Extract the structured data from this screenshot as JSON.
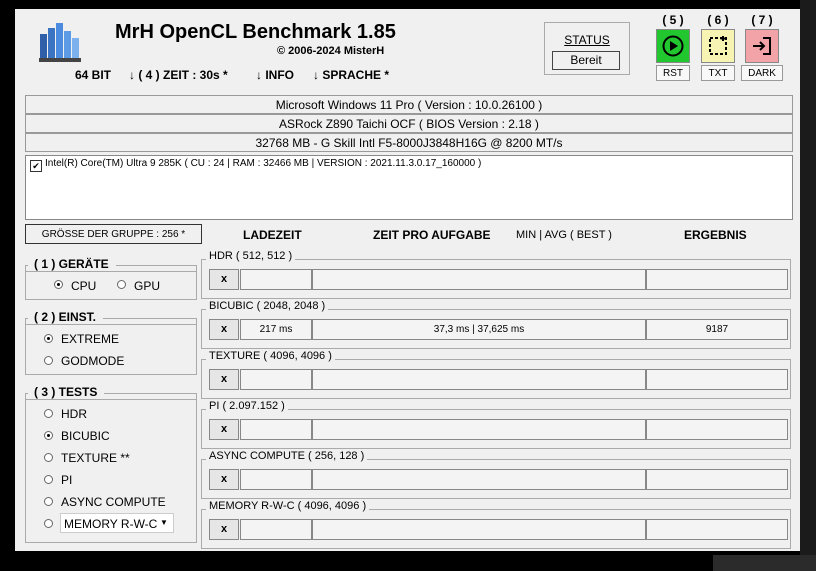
{
  "app": {
    "title": "MrH OpenCL Benchmark 1.85",
    "copyright": "© 2006-2024 MisterH"
  },
  "menu": {
    "bits": "64 BIT",
    "time": "↓ ( 4 ) ZEIT : 30s *",
    "info": "↓ INFO",
    "language": "↓ SPRACHE *"
  },
  "status": {
    "label": "STATUS",
    "value": "Bereit"
  },
  "toolbar": [
    {
      "num": "( 5 )",
      "label": "RST",
      "icon": "play-icon",
      "color": "#22c62e"
    },
    {
      "num": "( 6 )",
      "label": "TXT",
      "icon": "select-icon",
      "color": "#f6f3b3"
    },
    {
      "num": "( 7 )",
      "label": "DARK",
      "icon": "exit-icon",
      "color": "#f2a3a8"
    }
  ],
  "system": {
    "os": "Microsoft Windows 11 Pro ( Version : 10.0.26100 )",
    "board": "ASRock Z890 Taichi OCF ( BIOS Version : 2.18 )",
    "memory": "32768 MB - G Skill Intl F5-8000J3848H16G    @ 8200 MT/s"
  },
  "device": {
    "checked": true,
    "text": "Intel(R) Core(TM) Ultra 9 285K ( CU : 24 | RAM : 32466 MB | VERSION : 2021.11.3.0.17_160000 )"
  },
  "group_size": "GRÖSSE DER GRUPPE : 256 *",
  "columns": {
    "load": "LADEZEIT",
    "per_task": "ZEIT PRO AUFGABE",
    "minavg": "MIN | AVG ( BEST )",
    "result": "ERGEBNIS"
  },
  "devices_group": {
    "title": "( 1 ) GERÄTE",
    "options": [
      "CPU",
      "GPU"
    ],
    "selected": "CPU"
  },
  "settings_group": {
    "title": "( 2 ) EINST.",
    "options": [
      "EXTREME",
      "GODMODE"
    ],
    "selected": "EXTREME"
  },
  "tests_group": {
    "title": "( 3 ) TESTS",
    "options": [
      "HDR",
      "BICUBIC",
      "TEXTURE **",
      "PI",
      "ASYNC COMPUTE"
    ],
    "selected": "BICUBIC",
    "dropdown": "MEMORY R-W-C"
  },
  "tests": [
    {
      "name": "HDR ( 512, 512 )",
      "button": "x",
      "load": "",
      "time": "",
      "result": ""
    },
    {
      "name": "BICUBIC ( 2048, 2048 )",
      "button": "x",
      "load": "217 ms",
      "time": "37,3 ms | 37,625 ms",
      "result": "9187"
    },
    {
      "name": "TEXTURE ( 4096, 4096 )",
      "button": "x",
      "load": "",
      "time": "",
      "result": ""
    },
    {
      "name": "PI ( 2.097.152 )",
      "button": "x",
      "load": "",
      "time": "",
      "result": ""
    },
    {
      "name": "ASYNC COMPUTE ( 256, 128 )",
      "button": "x",
      "load": "",
      "time": "",
      "result": ""
    },
    {
      "name": "MEMORY R-W-C ( 4096, 4096 )",
      "button": "x",
      "load": "",
      "time": "",
      "result": ""
    }
  ]
}
